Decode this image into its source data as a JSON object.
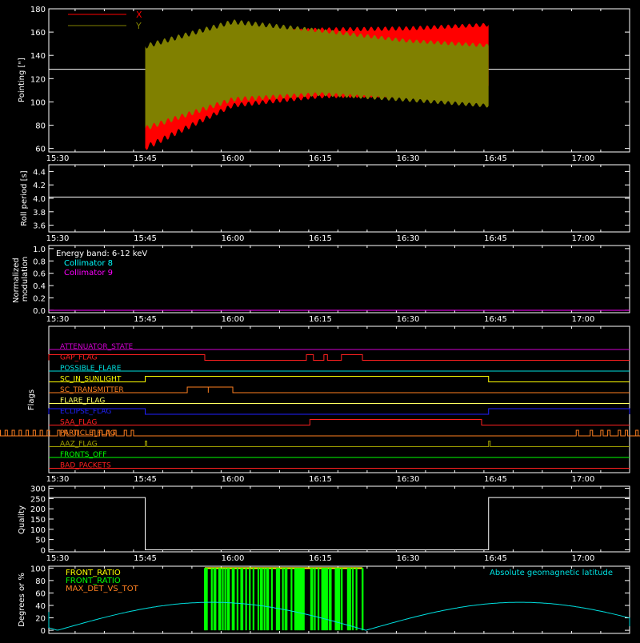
{
  "chart_data": [
    {
      "type": "line",
      "ylabel": "Pointing [\"]",
      "ylim": [
        57,
        180
      ],
      "yticks": [
        60,
        80,
        100,
        120,
        140,
        160,
        180
      ],
      "xticks": [
        "15:30",
        "15:45",
        "16:00",
        "16:15",
        "16:30",
        "16:45",
        "17:00"
      ],
      "legend": [
        "X",
        "Y"
      ],
      "colors": {
        "X": "#ff0000",
        "Y": "#808000",
        "reference": "#ffffff"
      },
      "reference_line": 128,
      "time_range": [
        "15:45",
        "16:44"
      ],
      "series": [
        {
          "name": "X",
          "lower_envelope": [
            [
              15.75,
              58
            ],
            [
              16.0,
              95
            ],
            [
              16.25,
              103
            ],
            [
              16.5,
              104
            ],
            [
              16.73,
              112
            ]
          ],
          "upper_envelope": [
            [
              15.75,
              145
            ],
            [
              16.0,
              160
            ],
            [
              16.25,
              164
            ],
            [
              16.5,
              165
            ],
            [
              16.73,
              168
            ]
          ]
        },
        {
          "name": "Y",
          "lower_envelope": [
            [
              15.75,
              75
            ],
            [
              16.0,
              100
            ],
            [
              16.25,
              105
            ],
            [
              16.5,
              100
            ],
            [
              16.73,
              95
            ]
          ],
          "upper_envelope": [
            [
              15.75,
              150
            ],
            [
              16.0,
              171
            ],
            [
              16.25,
              163
            ],
            [
              16.5,
              154
            ],
            [
              16.73,
              150
            ]
          ]
        }
      ]
    },
    {
      "type": "line",
      "ylabel": "Roll period [s]",
      "ylim": [
        3.5,
        4.5
      ],
      "yticks": [
        "3.6",
        "3.8",
        "4.0",
        "4.2",
        "4.4"
      ],
      "xticks": [
        "15:30",
        "15:45",
        "16:00",
        "16:15",
        "16:30",
        "16:45",
        "17:00"
      ],
      "series": [
        {
          "name": "",
          "constant": 4.02,
          "color": "#ffffff"
        }
      ]
    },
    {
      "type": "line",
      "ylabel": [
        "Normalized",
        "modulation"
      ],
      "ylim": [
        0,
        1
      ],
      "yticks": [
        "0.0",
        "0.2",
        "0.4",
        "0.6",
        "0.8",
        "1.0"
      ],
      "xticks": [
        "15:30",
        "15:45",
        "16:00",
        "16:15",
        "16:30",
        "16:45",
        "17:00"
      ],
      "legend_title": "Energy band: 6-12 keV",
      "legend": [
        "Collimator 8",
        "Collimator 9"
      ],
      "colors": {
        "Collimator 8": "#00ffff",
        "Collimator 9": "#ff00ff"
      },
      "series": [
        {
          "name": "Collimator 9",
          "constant": 0.0
        }
      ]
    },
    {
      "type": "line",
      "ylabel": "Flags",
      "xticks": [
        "15:30",
        "15:45",
        "16:00",
        "16:15",
        "16:30",
        "16:45",
        "17:00"
      ],
      "flags": [
        {
          "name": "ATTENUATOR_STATE",
          "color": "#d000d0",
          "low_segments": []
        },
        {
          "name": "GAP_FLAG",
          "color": "#ff2020",
          "high_segments": [
            [
              15.3,
              15.92
            ],
            [
              16.21,
              16.23
            ],
            [
              16.26,
              16.27
            ],
            [
              16.31,
              16.37
            ]
          ]
        },
        {
          "name": "POSSIBLE_FLARE",
          "color": "#00e0e0",
          "high_segments": []
        },
        {
          "name": "SC_IN_SUNLIGHT",
          "color": "#ffff00",
          "high_segments": [
            [
              15.75,
              16.73
            ]
          ]
        },
        {
          "name": "SC_TRANSMITTER",
          "color": "#ff8020",
          "high_segments": [
            [
              15.87,
              15.93
            ],
            [
              15.93,
              16.0
            ]
          ]
        },
        {
          "name": "FLARE_FLAG",
          "color": "#ffff60",
          "high_segments": []
        },
        {
          "name": "ECLIPSE_FLAG",
          "color": "#2020ff",
          "high_segments": [
            [
              15.3,
              15.75
            ],
            [
              16.73,
              17.22
            ]
          ]
        },
        {
          "name": "SAA_FLAG",
          "color": "#ff2020",
          "high_segments": [
            [
              16.22,
              16.71
            ]
          ]
        },
        {
          "name": "PARTICLE_FLAG",
          "color": "#ff8020",
          "pulses": "many"
        },
        {
          "name": "AAZ_FLAG",
          "color": "#a0a000",
          "pulses": [
            15.75,
            16.73
          ]
        },
        {
          "name": "FRONTS_OFF",
          "color": "#00ff00",
          "high_segments": []
        },
        {
          "name": "BAD_PACKETS",
          "color": "#ff2020",
          "high_segments": []
        }
      ]
    },
    {
      "type": "line",
      "ylabel": "Quality",
      "ylim": [
        0,
        300
      ],
      "yticks": [
        "0",
        "50",
        "100",
        "150",
        "200",
        "250",
        "300"
      ],
      "xticks": [
        "15:30",
        "15:45",
        "16:00",
        "16:15",
        "16:30",
        "16:45",
        "17:00"
      ],
      "series": [
        {
          "name": "",
          "segments": [
            [
              15.3,
              15.75,
              255
            ],
            [
              15.75,
              16.73,
              0
            ],
            [
              16.73,
              17.22,
              255
            ]
          ],
          "color": "#ffffff"
        }
      ]
    },
    {
      "type": "area",
      "ylabel": "Degrees or %",
      "ylim": [
        0,
        100
      ],
      "yticks": [
        "0",
        "20",
        "40",
        "60",
        "80",
        "100"
      ],
      "xticks": [
        "15:30",
        "15:45",
        "16:00",
        "16:15",
        "16:30",
        "16:45",
        "17:00"
      ],
      "legend": [
        "FRONT_RATIO",
        "FRONT_RATIO",
        "MAX_DET_VS_TOT"
      ],
      "legend_colors": [
        "#ffff00",
        "#00ff00",
        "#ff8020"
      ],
      "annotation": "Absolute geomagnetic latitude",
      "annotation_color": "#00e0e0",
      "geomagnetic_latitude": [
        [
          15.3,
          20
        ],
        [
          15.5,
          2
        ],
        [
          15.75,
          30
        ],
        [
          16.0,
          45
        ],
        [
          16.25,
          25
        ],
        [
          16.38,
          2
        ],
        [
          16.55,
          25
        ],
        [
          16.78,
          45
        ],
        [
          17.0,
          25
        ],
        [
          17.22,
          0
        ]
      ],
      "front_ratio_range": [
        15.92,
        16.37
      ]
    }
  ]
}
